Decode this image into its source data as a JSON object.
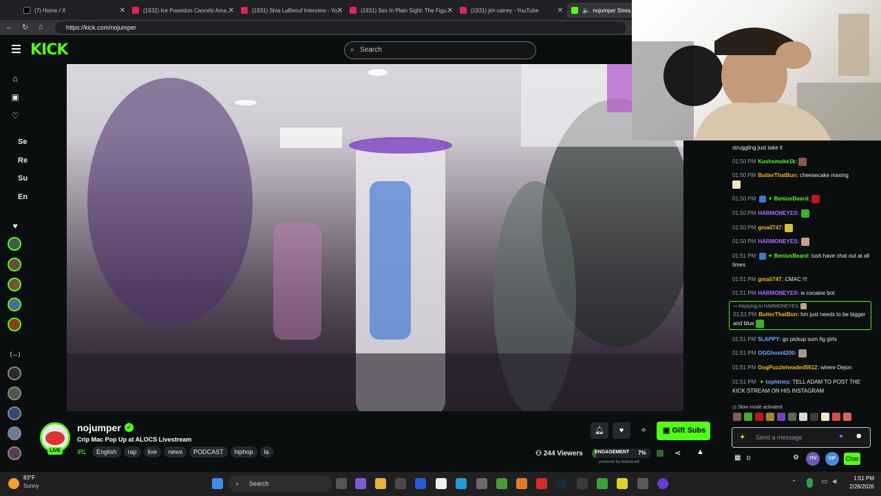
{
  "browser": {
    "tabs": [
      {
        "label": "(7) Home / X"
      },
      {
        "label": "(1932) Ice Poseidon Cancels Ama..."
      },
      {
        "label": "(1931) Shia LaBeouf Interview - Yo..."
      },
      {
        "label": "(1931) Sex In Plain Sight: The Figu..."
      },
      {
        "label": "(1931) jim carrey - YouTube"
      },
      {
        "label": "nojumper Strea..."
      }
    ],
    "url": "https://kick.com/nojumper"
  },
  "site": {
    "logo": "KICK",
    "search_placeholder": "Search"
  },
  "sidebar": {
    "section_labels": [
      "Se",
      "Re",
      "Su",
      "En"
    ]
  },
  "stream": {
    "channel": "nojumper",
    "title": "Crip Mac Pop Up at ALOCS Livestream",
    "category": "IRL",
    "live_badge": "LIVE",
    "tags": [
      "English",
      "rap",
      "live",
      "news",
      "PODCAST",
      "hiphop",
      "la"
    ],
    "viewers": "244 Viewers",
    "gift_button": "Gift Subs",
    "engagement_label": "ENGAGEMENT",
    "engagement_pct": "7%",
    "engagement_value": 0.07,
    "powered_by": "powered by botted.wtf"
  },
  "chat": {
    "messages": [
      {
        "time": "",
        "user": "",
        "text": "struggling just take it"
      },
      {
        "time": "01:50 PM",
        "user": "Kushsmoke1k:",
        "text": ""
      },
      {
        "time": "01:50 PM",
        "user": "ButterThatBun:",
        "text": "cheesecake maxing"
      },
      {
        "time": "01:50 PM",
        "user": "BeniusBeard:",
        "text": ""
      },
      {
        "time": "01:50 PM",
        "user": "HARMONEYES:",
        "text": ""
      },
      {
        "time": "01:50 PM",
        "user": "gmail747:",
        "text": ""
      },
      {
        "time": "01:50 PM",
        "user": "HARMONEYES:",
        "text": ""
      },
      {
        "time": "01:51 PM",
        "user": "BeniusBeard:",
        "text": "lush have chat out at all times"
      },
      {
        "time": "01:51 PM",
        "user": "gmail747:",
        "text": "CMAC !!!"
      },
      {
        "time": "01:51 PM",
        "user": "HARMONEYES:",
        "text": "w cocaine bot"
      },
      {
        "time": "01:51 PM",
        "user": "ButterThatBun:",
        "text": "hm just needs to be bigger and blue",
        "reply": "Replying to HARMONEYES:"
      },
      {
        "time": "01:51 PM",
        "user": "5LAPPY:",
        "text": "go pickup sum fig girls"
      },
      {
        "time": "01:51 PM",
        "user": "OGGhost4200:",
        "text": ""
      },
      {
        "time": "01:51 PM",
        "user": "DogPuzzleheaded5612:",
        "text": "where Dejon"
      },
      {
        "time": "01:51 PM",
        "user": "tophtries:",
        "text": "TELL ADAM TO POST THE KICK STREAM ON HIS INSTAGRAM"
      }
    ],
    "slow_mode": "Slow mode activated",
    "input_placeholder": "Send a message",
    "count": "0",
    "chat_button": "Chat",
    "badge_7tv": "7TV",
    "badge_ffz": "GIF"
  },
  "taskbar": {
    "temp": "83°F",
    "weather": "Sunny",
    "search": "Search",
    "time": "1:51 PM",
    "date": "2/28/2026"
  },
  "colors": {
    "kick_green": "#53fc18",
    "bg": "#0b0e0f",
    "reply_border": "#53fc18"
  }
}
